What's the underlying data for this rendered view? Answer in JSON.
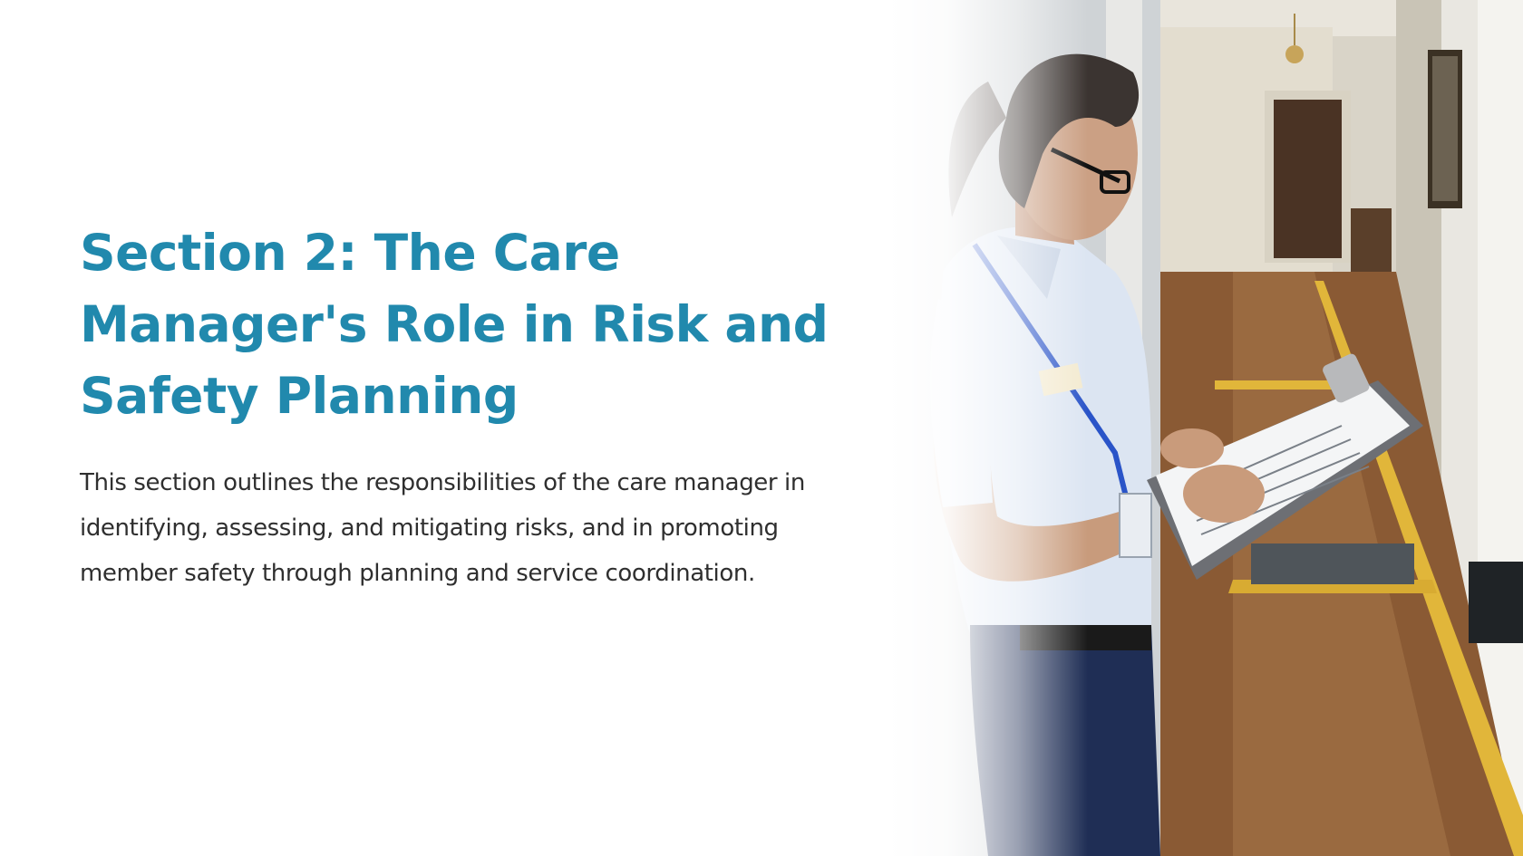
{
  "slide": {
    "title": "Section 2: The Care Manager's Role in Risk and Safety Planning",
    "body": "This section outlines the responsibilities of the care manager in identifying, assessing, and mitigating risks, and in promoting member safety through planning and service coordination."
  },
  "colors": {
    "title": "#2189ad",
    "body_text": "#2f2f2f",
    "background": "#ffffff"
  },
  "image": {
    "name": "care-manager-photo"
  }
}
